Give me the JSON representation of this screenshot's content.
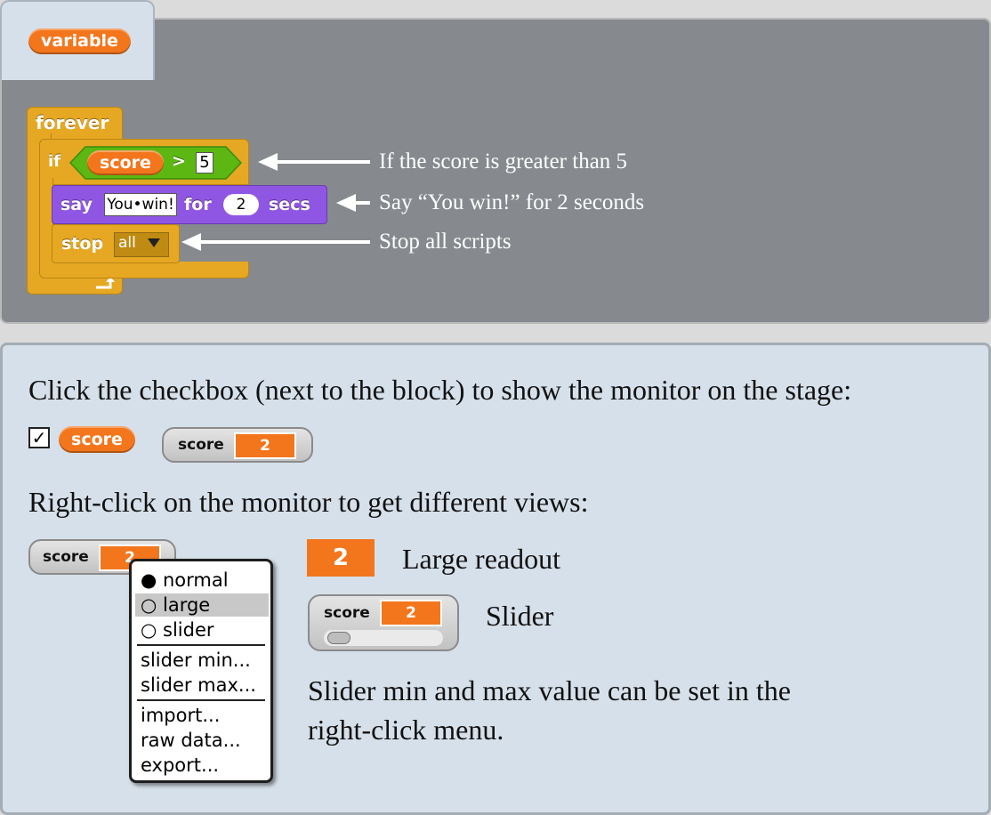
{
  "variable_tab": {
    "label": "variable"
  },
  "script": {
    "forever": "forever",
    "if": "if",
    "var": "score",
    "op": ">",
    "num": "5",
    "say": "say",
    "say_text": "You•win!",
    "for": "for",
    "secs_val": "2",
    "secs": "secs",
    "stop": "stop",
    "stop_opt": "all"
  },
  "annotations": [
    "If the score is greater than 5",
    "Say “You win!” for 2 seconds",
    "Stop all scripts"
  ],
  "monitor_help": {
    "intro": "Click the checkbox (next to the block) to show the monitor on the stage:",
    "checkbox_mark": "✓",
    "var_pill": "score",
    "monitor_label": "score",
    "monitor_value": "2",
    "views_intro": "Right-click on the monitor to get different views:",
    "context_menu": [
      "● normal",
      "○ large",
      "○ slider",
      "slider min...",
      "slider max...",
      "import...",
      "raw data...",
      "export..."
    ],
    "large_value": "2",
    "large_label": "Large readout",
    "slider_label": "Slider",
    "note_line1": "Slider min and max value can be set in the",
    "note_line2": "right-click menu."
  },
  "colors": {
    "variable_orange": "#f3761d",
    "control_yellow": "#e6a822",
    "looks_purple": "#8f56e3",
    "panel_gray": "#868a8e",
    "panel_blue": "#d6e0ea"
  },
  "slider_level": 0.0
}
